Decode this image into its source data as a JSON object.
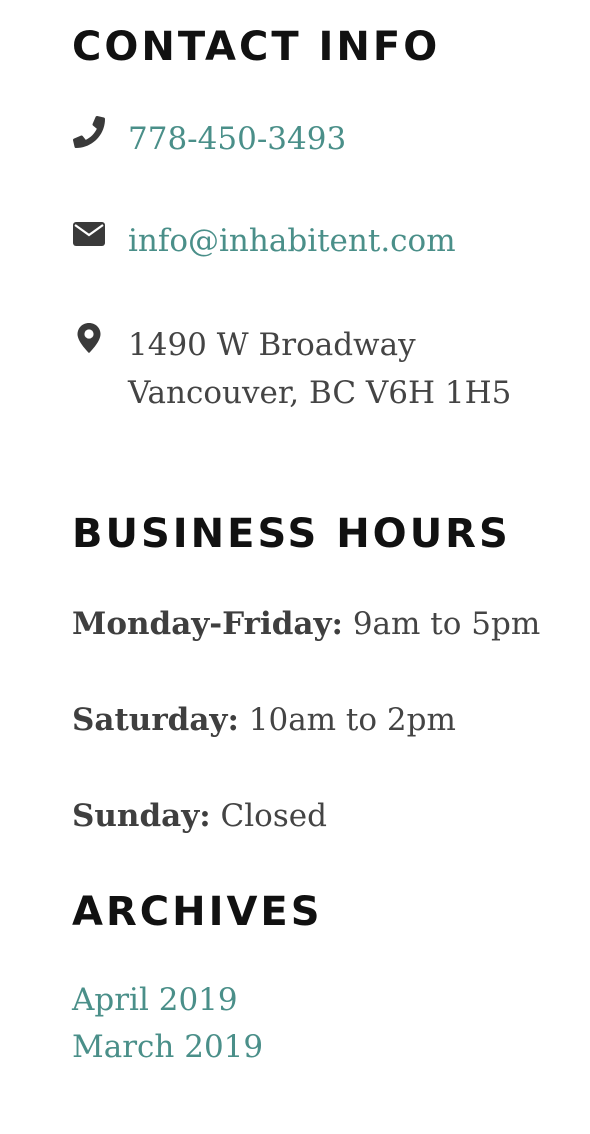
{
  "contact": {
    "heading": "CONTACT INFO",
    "phone": "778-450-3493",
    "email": "info@inhabitent.com",
    "address_line1": "1490 W Broadway",
    "address_line2": "Vancouver, BC V6H 1H5",
    "icons": [
      "phone-icon",
      "envelope-icon",
      "map-marker-icon"
    ]
  },
  "hours": {
    "heading": "BUSINESS HOURS",
    "items": [
      {
        "day": "Monday-Friday:",
        "time": "9am to 5pm"
      },
      {
        "day": "Saturday:",
        "time": "10am to 2pm"
      },
      {
        "day": "Sunday:",
        "time": "Closed"
      }
    ]
  },
  "archives": {
    "heading": "ARCHIVES",
    "links": [
      "April 2019",
      "March 2019"
    ]
  },
  "colors": {
    "link": "#4a8f89",
    "heading": "#111111",
    "text": "#444444",
    "icon": "#3a3a3a"
  }
}
